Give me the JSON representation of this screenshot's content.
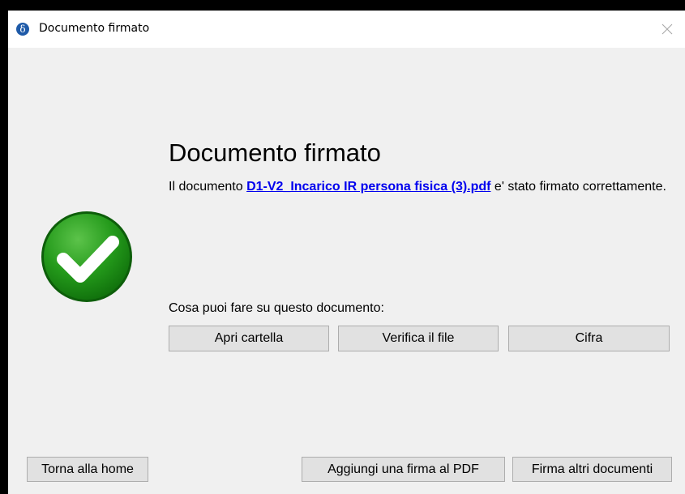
{
  "window": {
    "title": "Documento firmato",
    "app_icon_glyph": "δ",
    "app_icon_color": "#1e5aa8",
    "close_icon": "close-icon"
  },
  "status": {
    "icon": "checkmark-circle-icon",
    "color": "#1a8a12",
    "heading": "Documento firmato",
    "message_prefix": "Il documento ",
    "file_name": "D1-V2_Incarico IR persona fisica (3).pdf",
    "message_suffix": " e' stato firmato correttamente."
  },
  "actions": {
    "label": "Cosa puoi fare su questo documento:",
    "open_folder": "Apri cartella",
    "verify_file": "Verifica il file",
    "encrypt": "Cifra"
  },
  "footer": {
    "home": "Torna alla home",
    "add_signature": "Aggiungi una firma al PDF",
    "sign_other": "Firma altri documenti"
  }
}
